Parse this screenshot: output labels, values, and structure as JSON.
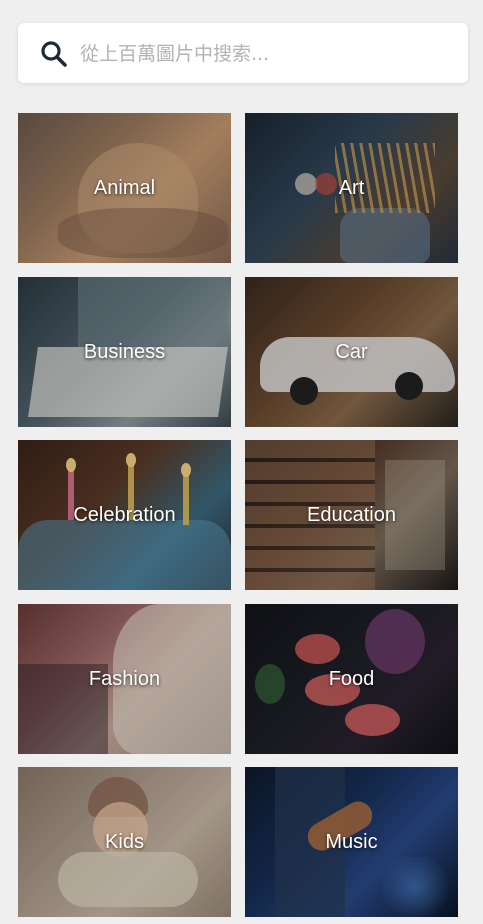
{
  "search": {
    "placeholder": "從上百萬圖片中搜索...",
    "value": ""
  },
  "categories": [
    {
      "label": "Animal",
      "bg": "linear-gradient(135deg, #6b5a4e 0%, #9c7a5e 35%, #c79a72 60%, #8a6a55 100%)"
    },
    {
      "label": "Art",
      "bg": "linear-gradient(135deg, #1c2733 0%, #31465a 40%, #5a4a3a 70%, #2a3442 100%)"
    },
    {
      "label": "Business",
      "bg": "linear-gradient(135deg, #2b3a44 0%, #55646d 45%, #8e9aa0 70%, #3c4a52 100%)"
    },
    {
      "label": "Car",
      "bg": "linear-gradient(135deg, #3a2a20 0%, #6b4a30 40%, #8a6a4a 65%, #2a2620 100%)"
    },
    {
      "label": "Celebration",
      "bg": "linear-gradient(135deg, #3a2418 0%, #5a3a28 40%, #3d6a80 70%, #2a2a30 100%)"
    },
    {
      "label": "Education",
      "bg": "linear-gradient(135deg, #2a1f18 0%, #5a4030 40%, #7a6a5a 65%, #1e1a18 100%)"
    },
    {
      "label": "Fashion",
      "bg": "linear-gradient(135deg, #6a3a3a 0%, #a06a6a 35%, #c8aaa0 60%, #8a7a70 100%)"
    },
    {
      "label": "Food",
      "bg": "linear-gradient(135deg, #12141a 0%, #1e2028 45%, #2a2230 70%, #101218 100%)"
    },
    {
      "label": "Kids",
      "bg": "linear-gradient(135deg, #8a7a6a 0%, #b0a090 40%, #c8b8a6 65%, #9a8a78 100%)"
    },
    {
      "label": "Music",
      "bg": "linear-gradient(135deg, #0e1a2e 0%, #18305a 40%, #2a4a8a 65%, #0a1424 100%)"
    }
  ]
}
